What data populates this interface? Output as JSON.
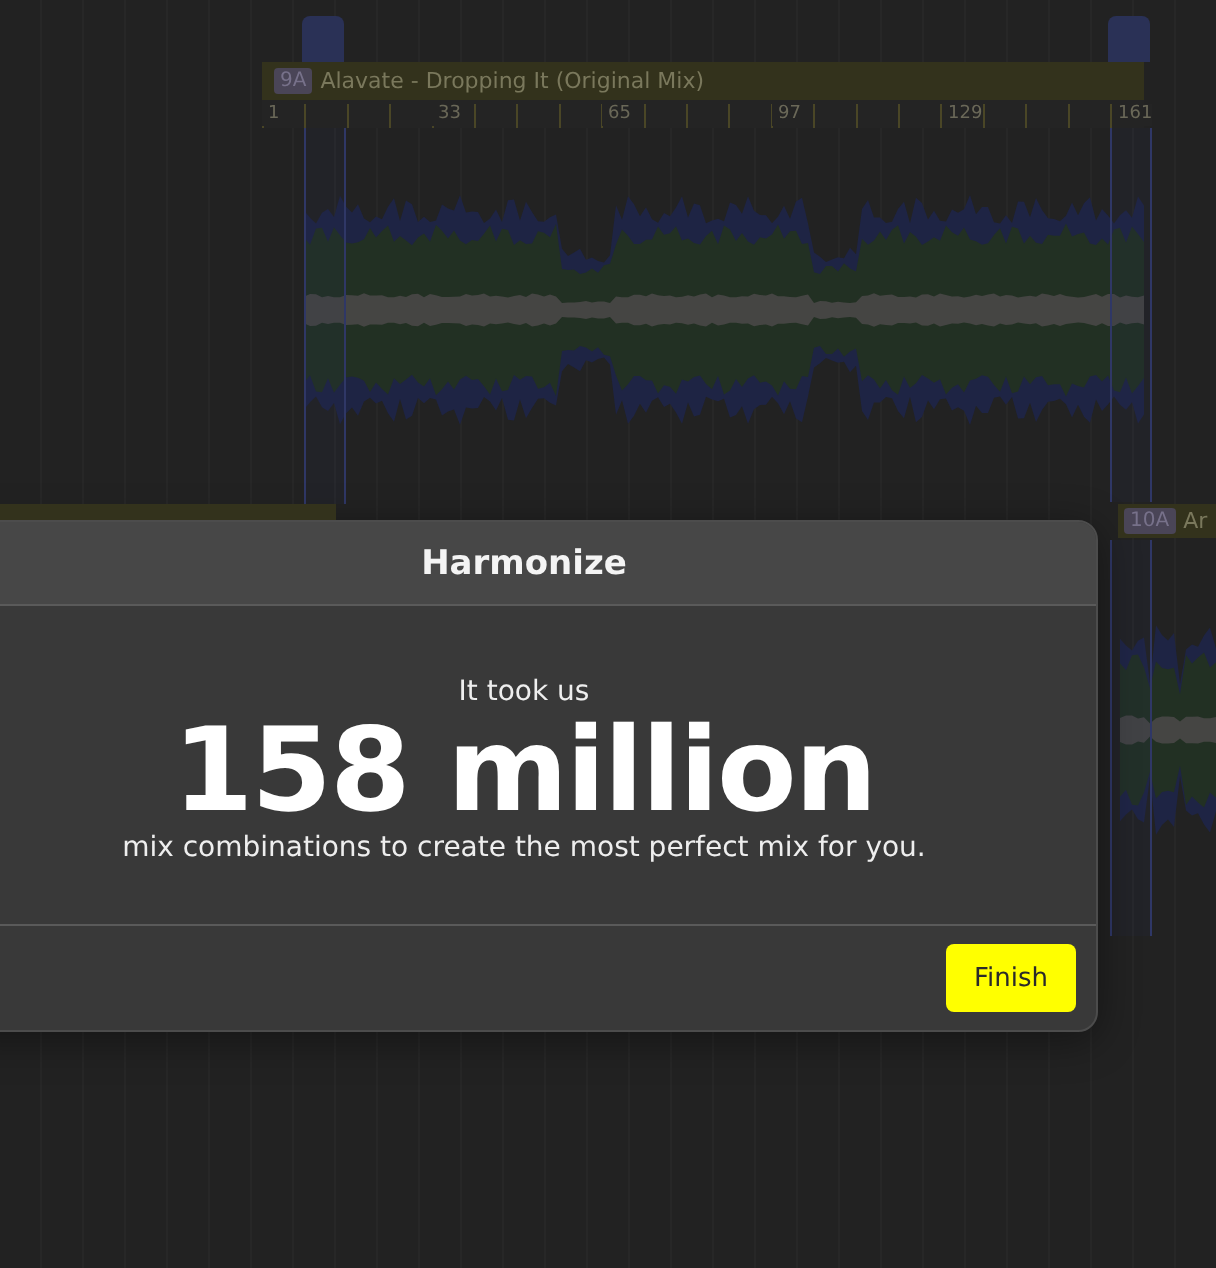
{
  "timeline": {
    "clips": [
      {
        "key": "9A",
        "title": "Alavate - Dropping It (Original Mix)",
        "ruler": [
          "1",
          "33",
          "65",
          "97",
          "129",
          "161"
        ]
      },
      {
        "key": "10A",
        "title": "Ar"
      }
    ]
  },
  "dialog": {
    "title": "Harmonize",
    "lead": "It took us",
    "figure": "158 million",
    "caption": "mix combinations to create the most perfect mix for you.",
    "buttons": [
      "Finish"
    ]
  }
}
